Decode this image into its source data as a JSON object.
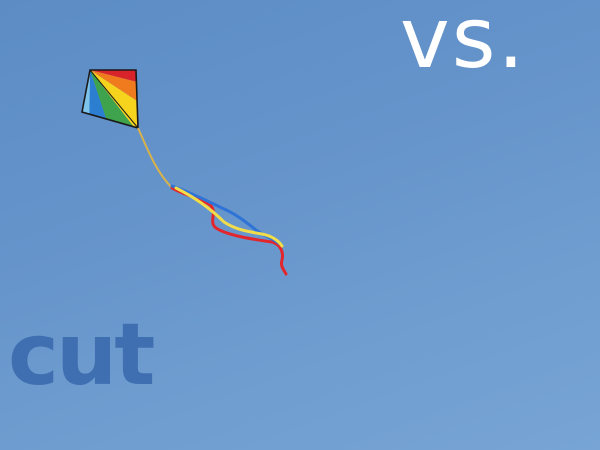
{
  "overlay": {
    "top_word": "vs.",
    "bottom_word": "cut"
  },
  "colors": {
    "sky": "#6594cb",
    "top_word_color": "#ffffff",
    "bottom_word_color": "#3f6fb0"
  },
  "kite": {
    "stripe_colors": [
      "#d8232a",
      "#f07a1e",
      "#f6d31d",
      "#3fa34d",
      "#2c7fd0",
      "#7ec3ea"
    ],
    "tail_colors": [
      "#e2262c",
      "#2f73d6",
      "#f1dd4a"
    ]
  }
}
